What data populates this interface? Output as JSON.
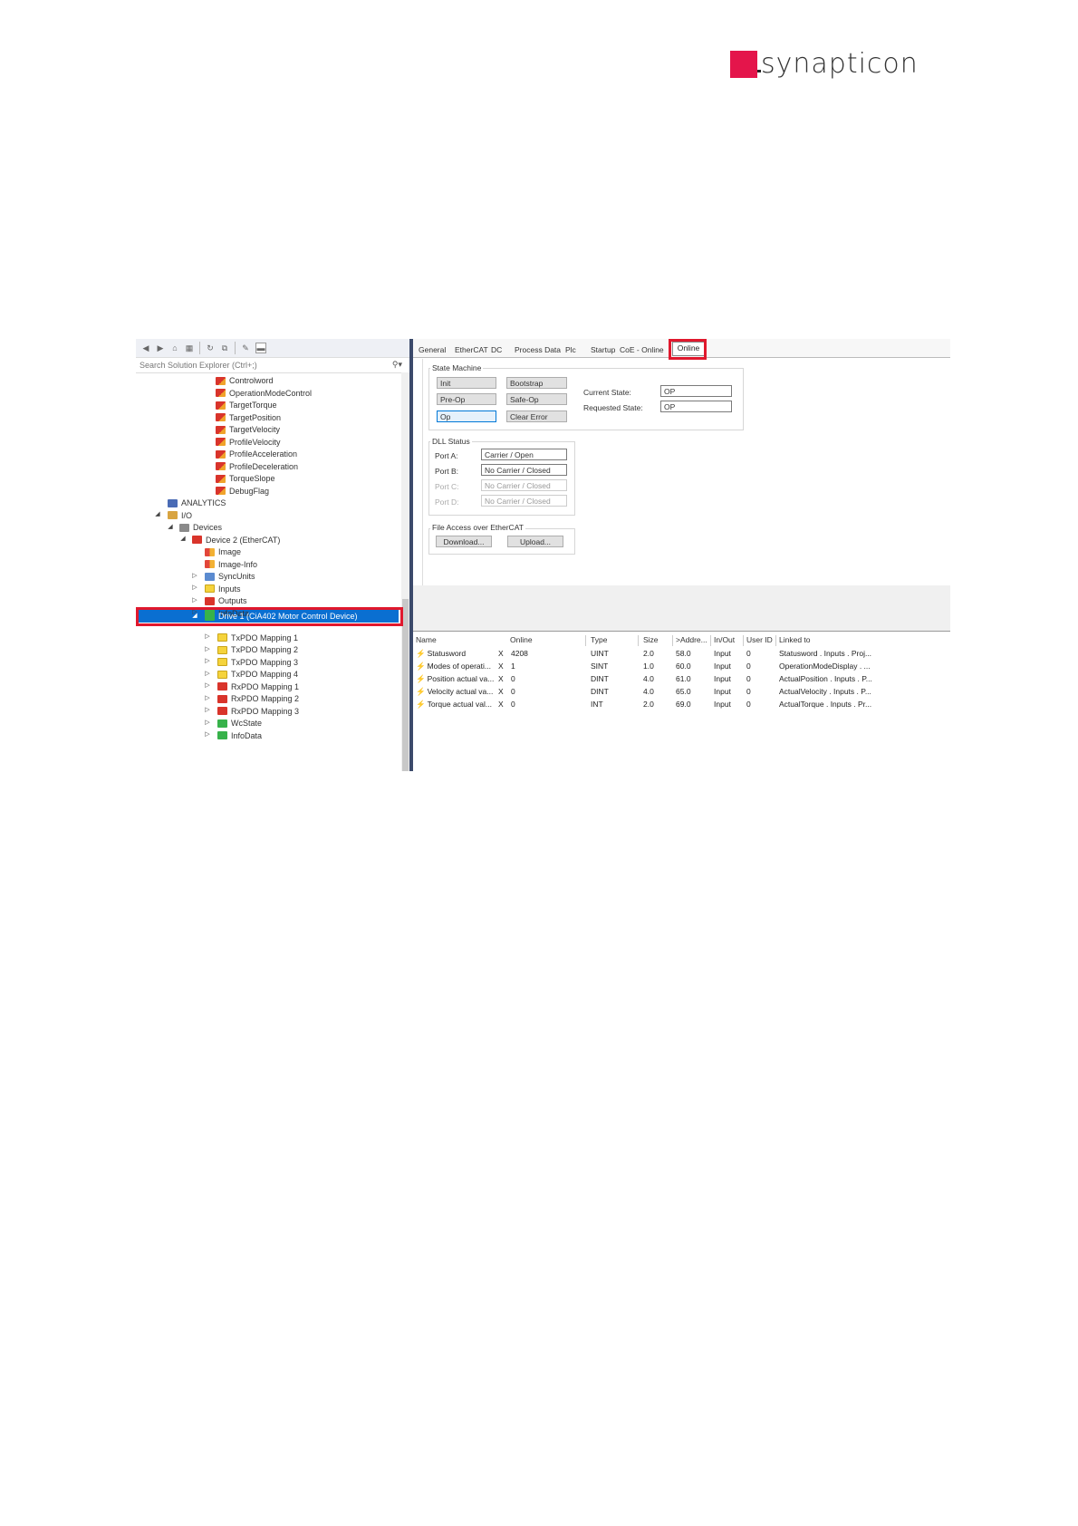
{
  "brand": {
    "logo_text": "synapticon",
    "accent_color": "#e4154b"
  },
  "solution_explorer": {
    "search_placeholder": "Search Solution Explorer (Ctrl+;)",
    "tree": [
      {
        "label": "Controlword",
        "icon": "output-var",
        "twisty": ""
      },
      {
        "label": "OperationModeControl",
        "icon": "output-var",
        "twisty": ""
      },
      {
        "label": "TargetTorque",
        "icon": "output-var",
        "twisty": ""
      },
      {
        "label": "TargetPosition",
        "icon": "output-var",
        "twisty": ""
      },
      {
        "label": "TargetVelocity",
        "icon": "output-var",
        "twisty": ""
      },
      {
        "label": "ProfileVelocity",
        "icon": "output-var",
        "twisty": ""
      },
      {
        "label": "ProfileAcceleration",
        "icon": "output-var",
        "twisty": ""
      },
      {
        "label": "ProfileDeceleration",
        "icon": "output-var",
        "twisty": ""
      },
      {
        "label": "TorqueSlope",
        "icon": "output-var",
        "twisty": ""
      },
      {
        "label": "DebugFlag",
        "icon": "output-var",
        "twisty": ""
      },
      {
        "label": "ANALYTICS",
        "icon": "analytics",
        "twisty": ""
      },
      {
        "label": "I/O",
        "icon": "io",
        "twisty": "◢"
      },
      {
        "label": "Devices",
        "icon": "devices",
        "twisty": "◢"
      },
      {
        "label": "Device 2 (EtherCAT)",
        "icon": "device",
        "twisty": "◢"
      },
      {
        "label": "Image",
        "icon": "image",
        "twisty": ""
      },
      {
        "label": "Image-Info",
        "icon": "image",
        "twisty": ""
      },
      {
        "label": "SyncUnits",
        "icon": "syncunits",
        "twisty": "▷"
      },
      {
        "label": "Inputs",
        "icon": "inputs",
        "twisty": "▷"
      },
      {
        "label": "Outputs",
        "icon": "outputs",
        "twisty": "▷"
      },
      {
        "label": "InfoData",
        "icon": "infodata",
        "twisty": "▷"
      },
      {
        "label": "Drive 1 (CiA402 Motor Control Device)",
        "icon": "drive",
        "twisty": "◢"
      },
      {
        "label": "TxPDO Mapping 1",
        "icon": "txpdo",
        "twisty": "▷"
      },
      {
        "label": "TxPDO Mapping 2",
        "icon": "txpdo",
        "twisty": "▷"
      },
      {
        "label": "TxPDO Mapping 3",
        "icon": "txpdo",
        "twisty": "▷"
      },
      {
        "label": "TxPDO Mapping 4",
        "icon": "txpdo",
        "twisty": "▷"
      },
      {
        "label": "RxPDO Mapping 1",
        "icon": "rxpdo",
        "twisty": "▷"
      },
      {
        "label": "RxPDO Mapping 2",
        "icon": "rxpdo",
        "twisty": "▷"
      },
      {
        "label": "RxPDO Mapping 3",
        "icon": "rxpdo",
        "twisty": "▷"
      },
      {
        "label": "WcState",
        "icon": "wcstate",
        "twisty": "▷"
      },
      {
        "label": "InfoData",
        "icon": "infodata",
        "twisty": "▷"
      }
    ],
    "selected_item": "Drive 1 (CiA402 Motor Control Device)"
  },
  "tabs": [
    "General",
    "EtherCAT",
    "DC",
    "Process Data",
    "Plc",
    "Startup",
    "CoE - Online",
    "Online"
  ],
  "active_tab": "Online",
  "state_machine": {
    "title": "State Machine",
    "buttons": {
      "init": "Init",
      "bootstrap": "Bootstrap",
      "preop": "Pre-Op",
      "safeop": "Safe-Op",
      "op": "Op",
      "clear_error": "Clear Error"
    },
    "current_state_label": "Current State:",
    "current_state_value": "OP",
    "requested_state_label": "Requested State:",
    "requested_state_value": "OP"
  },
  "dll_status": {
    "title": "DLL Status",
    "ports": [
      {
        "label": "Port A:",
        "value": "Carrier / Open",
        "enabled": true
      },
      {
        "label": "Port B:",
        "value": "No Carrier / Closed",
        "enabled": true
      },
      {
        "label": "Port C:",
        "value": "No Carrier / Closed",
        "enabled": false
      },
      {
        "label": "Port D:",
        "value": "No Carrier / Closed",
        "enabled": false
      }
    ]
  },
  "file_access": {
    "title": "File Access over EtherCAT",
    "download": "Download...",
    "upload": "Upload..."
  },
  "variables_table": {
    "columns": [
      "Name",
      "Online",
      "Type",
      "Size",
      ">Addre...",
      "In/Out",
      "User ID",
      "Linked to"
    ],
    "rows": [
      {
        "name": "Statusword",
        "flag": "X",
        "online": "4208",
        "type": "UINT",
        "size": "2.0",
        "addr": "58.0",
        "inout": "Input",
        "userid": "0",
        "linked": "Statusword . Inputs . Proj..."
      },
      {
        "name": "Modes of operati...",
        "flag": "X",
        "online": "1",
        "type": "SINT",
        "size": "1.0",
        "addr": "60.0",
        "inout": "Input",
        "userid": "0",
        "linked": "OperationModeDisplay . ..."
      },
      {
        "name": "Position actual va...",
        "flag": "X",
        "online": "0",
        "type": "DINT",
        "size": "4.0",
        "addr": "61.0",
        "inout": "Input",
        "userid": "0",
        "linked": "ActualPosition . Inputs . P..."
      },
      {
        "name": "Velocity actual va...",
        "flag": "X",
        "online": "0",
        "type": "DINT",
        "size": "4.0",
        "addr": "65.0",
        "inout": "Input",
        "userid": "0",
        "linked": "ActualVelocity . Inputs . P..."
      },
      {
        "name": "Torque actual val...",
        "flag": "X",
        "online": "0",
        "type": "INT",
        "size": "2.0",
        "addr": "69.0",
        "inout": "Input",
        "userid": "0",
        "linked": "ActualTorque . Inputs . Pr..."
      }
    ]
  }
}
